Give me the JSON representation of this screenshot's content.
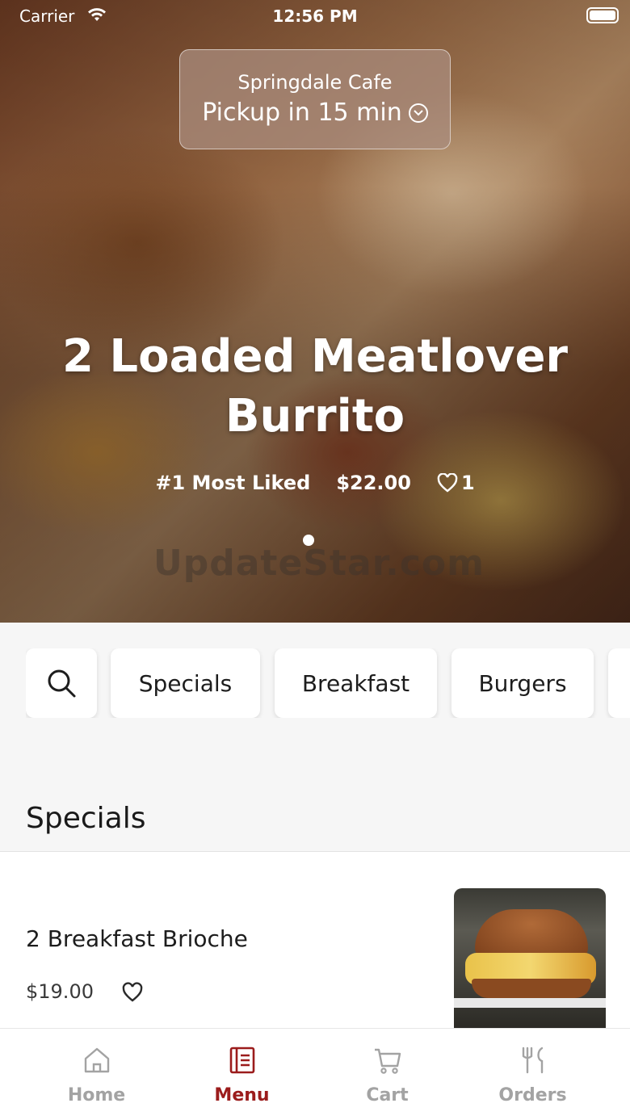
{
  "status_bar": {
    "carrier": "Carrier",
    "time": "12:56 PM"
  },
  "pickup": {
    "cafe": "Springdale Cafe",
    "pickup_time": "Pickup in 15 min"
  },
  "hero": {
    "title": "2 Loaded Meatlover Burrito",
    "badge": "#1 Most Liked",
    "price": "$22.00",
    "likes": "1",
    "watermark": "UpdateStar.com"
  },
  "categories": {
    "items": [
      {
        "label": "Specials"
      },
      {
        "label": "Breakfast"
      },
      {
        "label": "Burgers"
      }
    ]
  },
  "section": {
    "title": "Specials"
  },
  "menu_items": [
    {
      "name": "2 Breakfast Brioche",
      "price": "$19.00"
    }
  ],
  "tabbar": {
    "items": [
      {
        "label": "Home",
        "icon": "home-icon"
      },
      {
        "label": "Menu",
        "icon": "menu-icon"
      },
      {
        "label": "Cart",
        "icon": "cart-icon"
      },
      {
        "label": "Orders",
        "icon": "orders-icon"
      }
    ],
    "active": "Menu",
    "active_color": "#9b1c1c",
    "inactive_color": "#a3a3a3"
  }
}
